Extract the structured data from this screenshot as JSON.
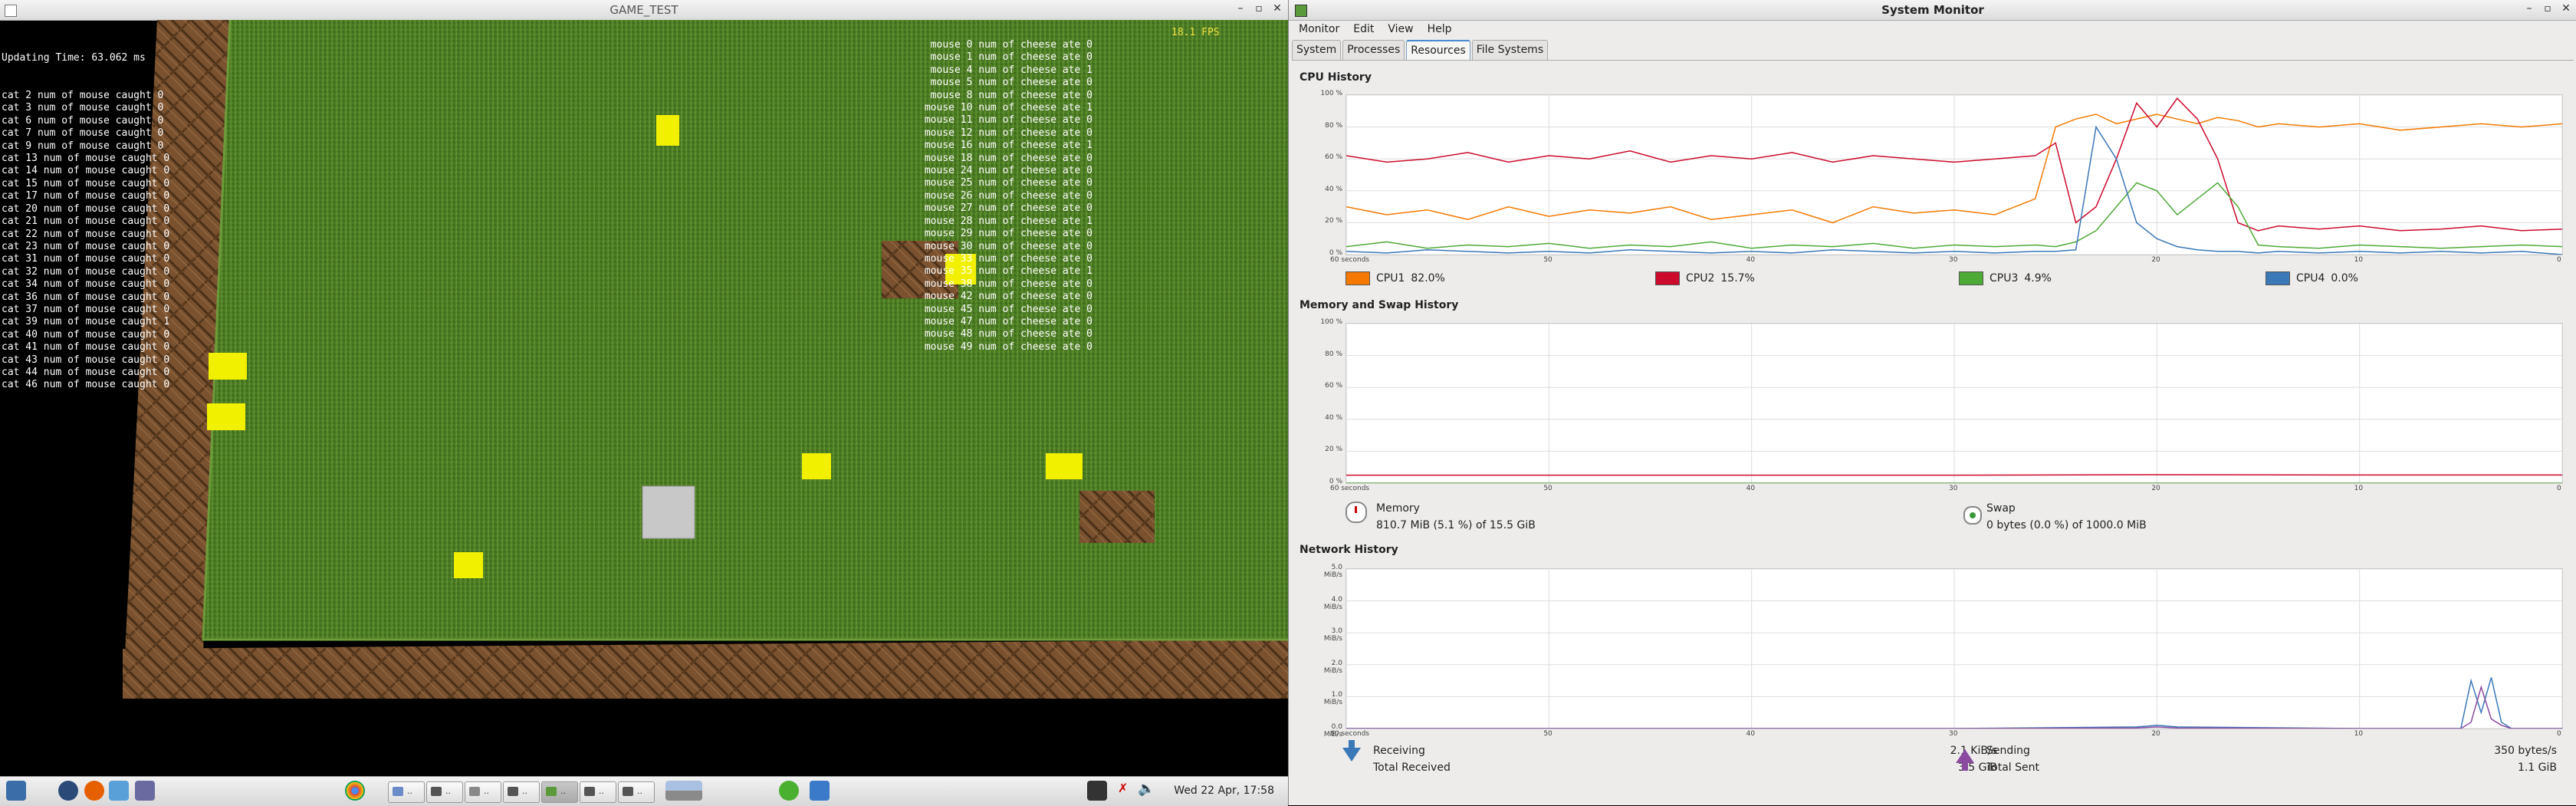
{
  "game": {
    "title": "GAME_TEST",
    "fps": "18.1 FPS",
    "updating_time": "Updating Time: 63.062 ms",
    "cats": [
      "cat 2 num of mouse caught 0",
      "cat 3 num of mouse caught 0",
      "cat 6 num of mouse caught 0",
      "cat 7 num of mouse caught 0",
      "cat 9 num of mouse caught 0",
      "cat 13 num of mouse caught 0",
      "cat 14 num of mouse caught 0",
      "cat 15 num of mouse caught 0",
      "cat 17 num of mouse caught 0",
      "cat 20 num of mouse caught 0",
      "cat 21 num of mouse caught 0",
      "cat 22 num of mouse caught 0",
      "cat 23 num of mouse caught 0",
      "cat 31 num of mouse caught 0",
      "cat 32 num of mouse caught 0",
      "cat 34 num of mouse caught 0",
      "cat 36 num of mouse caught 0",
      "cat 37 num of mouse caught 0",
      "cat 39 num of mouse caught 1",
      "cat 40 num of mouse caught 0",
      "cat 41 num of mouse caught 0",
      "cat 43 num of mouse caught 0",
      "cat 44 num of mouse caught 0",
      "cat 46 num of mouse caught 0"
    ],
    "mice": [
      "mouse 0 num of cheese ate 0",
      "mouse 1 num of cheese ate 0",
      "mouse 4 num of cheese ate 1",
      "mouse 5 num of cheese ate 0",
      "mouse 8 num of cheese ate 0",
      "mouse 10 num of cheese ate 1",
      "mouse 11 num of cheese ate 0",
      "mouse 12 num of cheese ate 0",
      "mouse 16 num of cheese ate 1",
      "mouse 18 num of cheese ate 0",
      "mouse 24 num of cheese ate 0",
      "mouse 25 num of cheese ate 0",
      "mouse 26 num of cheese ate 0",
      "mouse 27 num of cheese ate 0",
      "mouse 28 num of cheese ate 1",
      "mouse 29 num of cheese ate 0",
      "mouse 30 num of cheese ate 0",
      "mouse 33 num of cheese ate 0",
      "mouse 35 num of cheese ate 1",
      "mouse 38 num of cheese ate 0",
      "mouse 42 num of cheese ate 0",
      "mouse 45 num of cheese ate 0",
      "mouse 47 num of cheese ate 0",
      "mouse 48 num of cheese ate 0",
      "mouse 49 num of cheese ate 0"
    ],
    "colors": {
      "grass": "#4a7a22",
      "wood": "#7a5230",
      "cheese": "#f0f000",
      "fps": "#f0e040"
    }
  },
  "taskbar": {
    "clock": "Wed 22 Apr, 17:58",
    "window_labels": [
      "..",
      "..",
      "..",
      "..",
      "..",
      "..",
      ".."
    ]
  },
  "sysmon": {
    "title": "System Monitor",
    "menu": [
      "Monitor",
      "Edit",
      "View",
      "Help"
    ],
    "tabs": [
      "System",
      "Processes",
      "Resources",
      "File Systems"
    ],
    "active_tab": "Resources",
    "cpu": {
      "title": "CPU History",
      "yticks": [
        "100 %",
        "80 %",
        "60 %",
        "40 %",
        "20 %",
        "0 %"
      ],
      "xticks": [
        "60 seconds",
        "50",
        "40",
        "30",
        "20",
        "10",
        "0"
      ],
      "legend": [
        {
          "label": "CPU1",
          "value": "82.0%",
          "color": "#f57900"
        },
        {
          "label": "CPU2",
          "value": "15.7%",
          "color": "#cc0a2c"
        },
        {
          "label": "CPU3",
          "value": "4.9%",
          "color": "#4eaa36"
        },
        {
          "label": "CPU4",
          "value": "0.0%",
          "color": "#3a78b8"
        }
      ]
    },
    "memory": {
      "title": "Memory and Swap History",
      "yticks": [
        "100 %",
        "80 %",
        "60 %",
        "40 %",
        "20 %",
        "0 %"
      ],
      "xticks": [
        "60 seconds",
        "50",
        "40",
        "30",
        "20",
        "10",
        "0"
      ],
      "memory_label": "Memory",
      "memory_value": "810.7 MiB (5.1 %) of 15.5 GiB",
      "swap_label": "Swap",
      "swap_value": "0 bytes (0.0 %) of 1000.0 MiB"
    },
    "network": {
      "title": "Network History",
      "yticks": [
        "5.0 MiB/s",
        "4.0 MiB/s",
        "3.0 MiB/s",
        "2.0 MiB/s",
        "1.0 MiB/s",
        "0.0 MiB/s"
      ],
      "xticks": [
        "60 seconds",
        "50",
        "40",
        "30",
        "20",
        "10",
        "0"
      ],
      "receiving_label": "Receiving",
      "receiving_value": "2.1 KiB/s",
      "total_received_label": "Total Received",
      "total_received_value": "3.5 GiB",
      "sending_label": "Sending",
      "sending_value": "350 bytes/s",
      "total_sent_label": "Total Sent",
      "total_sent_value": "1.1 GiB"
    }
  },
  "chart_data": [
    {
      "type": "line",
      "title": "CPU History",
      "xlabel": "",
      "ylabel": "",
      "x": [
        60,
        58,
        56,
        54,
        52,
        50,
        48,
        46,
        44,
        42,
        40,
        38,
        36,
        34,
        32,
        30,
        28,
        26,
        25,
        24,
        23,
        22,
        21,
        20,
        19,
        18,
        17,
        16,
        15,
        14,
        12,
        10,
        8,
        6,
        4,
        2,
        0
      ],
      "ylim": [
        0,
        100
      ],
      "xlim": [
        60,
        0
      ],
      "series": [
        {
          "name": "CPU1",
          "values": [
            30,
            25,
            28,
            22,
            30,
            24,
            28,
            26,
            30,
            22,
            25,
            28,
            20,
            30,
            26,
            28,
            25,
            35,
            80,
            85,
            88,
            82,
            85,
            88,
            85,
            82,
            86,
            84,
            80,
            82,
            80,
            82,
            78,
            80,
            82,
            80,
            82
          ]
        },
        {
          "name": "CPU2",
          "values": [
            62,
            58,
            60,
            64,
            58,
            62,
            60,
            65,
            58,
            62,
            60,
            64,
            58,
            62,
            60,
            58,
            60,
            62,
            70,
            20,
            30,
            60,
            95,
            80,
            98,
            85,
            60,
            20,
            15,
            18,
            16,
            18,
            15,
            16,
            18,
            15,
            16
          ]
        },
        {
          "name": "CPU3",
          "values": [
            5,
            8,
            4,
            6,
            5,
            7,
            4,
            6,
            5,
            8,
            4,
            6,
            5,
            7,
            4,
            6,
            5,
            6,
            5,
            8,
            15,
            30,
            45,
            40,
            25,
            35,
            45,
            30,
            6,
            5,
            4,
            6,
            5,
            4,
            5,
            6,
            5
          ]
        },
        {
          "name": "CPU4",
          "values": [
            2,
            1,
            3,
            2,
            1,
            2,
            1,
            3,
            2,
            1,
            2,
            1,
            3,
            2,
            1,
            2,
            1,
            2,
            2,
            3,
            80,
            60,
            20,
            10,
            5,
            3,
            2,
            2,
            1,
            2,
            1,
            2,
            1,
            2,
            1,
            2,
            0
          ]
        }
      ]
    },
    {
      "type": "line",
      "title": "Memory and Swap History",
      "xlabel": "",
      "ylabel": "",
      "x": [
        60,
        50,
        40,
        30,
        20,
        10,
        0
      ],
      "ylim": [
        0,
        100
      ],
      "xlim": [
        60,
        0
      ],
      "series": [
        {
          "name": "Memory",
          "values": [
            5,
            5,
            5,
            5,
            5.3,
            5.1,
            5.1
          ]
        },
        {
          "name": "Swap",
          "values": [
            0,
            0,
            0,
            0,
            0,
            0,
            0
          ]
        }
      ]
    },
    {
      "type": "line",
      "title": "Network History",
      "xlabel": "",
      "ylabel": "",
      "x": [
        60,
        50,
        40,
        30,
        21,
        20,
        19,
        10,
        5,
        4.5,
        4,
        3.5,
        3,
        2.5,
        0
      ],
      "ylim": [
        0,
        5
      ],
      "xlim": [
        60,
        0
      ],
      "series": [
        {
          "name": "Receiving",
          "values": [
            0,
            0,
            0,
            0,
            0.05,
            0.1,
            0.05,
            0,
            0,
            1.5,
            0.5,
            1.6,
            0.2,
            0,
            0
          ]
        },
        {
          "name": "Sending",
          "values": [
            0,
            0,
            0,
            0,
            0.02,
            0.05,
            0.02,
            0,
            0,
            0.2,
            1.3,
            0.3,
            0.1,
            0,
            0
          ]
        }
      ]
    }
  ]
}
